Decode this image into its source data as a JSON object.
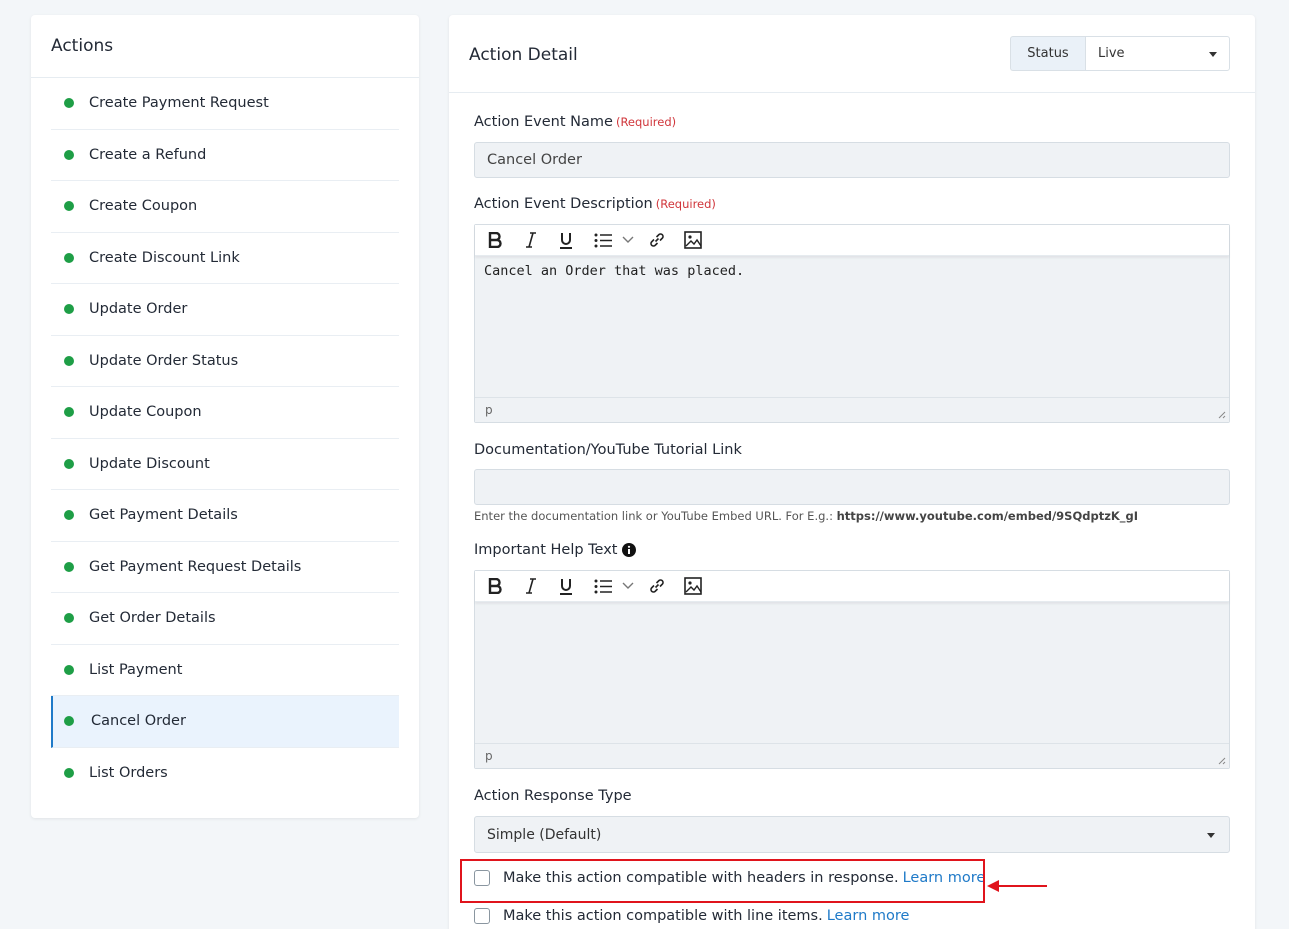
{
  "actions_panel": {
    "title": "Actions",
    "items": [
      {
        "label": "Create Payment Request"
      },
      {
        "label": "Create a Refund"
      },
      {
        "label": "Create Coupon"
      },
      {
        "label": "Create Discount Link"
      },
      {
        "label": "Update Order"
      },
      {
        "label": "Update Order Status"
      },
      {
        "label": "Update Coupon"
      },
      {
        "label": "Update Discount"
      },
      {
        "label": "Get Payment Details"
      },
      {
        "label": "Get Payment Request Details"
      },
      {
        "label": "Get Order Details"
      },
      {
        "label": "List Payment"
      },
      {
        "label": "Cancel Order"
      },
      {
        "label": "List Orders"
      }
    ],
    "active_index": 12,
    "status_color": "#1e9e46"
  },
  "detail": {
    "title": "Action Detail",
    "status_label": "Status",
    "status_value": "Live",
    "event_name_label": "Action Event Name",
    "required_text": "(Required)",
    "event_name_value": "Cancel Order",
    "event_desc_label": "Action Event Description",
    "event_desc_value": "Cancel an Order that was placed.",
    "editor_status": "p",
    "doc_link_label": "Documentation/YouTube Tutorial Link",
    "doc_link_value": "",
    "doc_hint": "Enter the documentation link or YouTube Embed URL. For E.g.:",
    "doc_hint_example": "https://www.youtube.com/embed/9SQdptzK_gI",
    "help_text_label": "Important Help Text",
    "help_text_value": "",
    "response_type_label": "Action Response Type",
    "response_type_value": "Simple (Default)",
    "checkbox_headers": "Make this action compatible with headers in response.",
    "checkbox_line_items": "Make this action compatible with line items.",
    "learn_more": "Learn more"
  },
  "colors": {
    "accent": "#1f7ac8",
    "required": "#d0363b",
    "annotation": "#e0141c"
  }
}
